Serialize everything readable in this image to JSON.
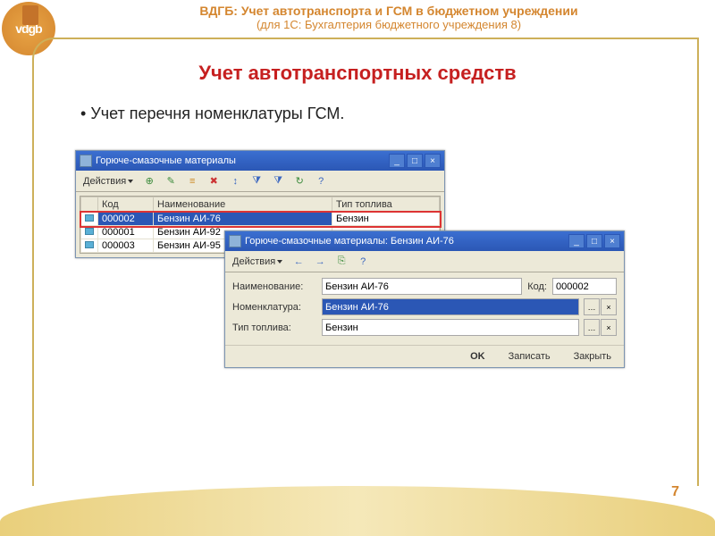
{
  "header": {
    "line1": "ВДГБ: Учет автотранспорта и ГСМ в бюджетном учреждении",
    "line2": "(для 1С: Бухгалтерия бюджетного учреждения 8)"
  },
  "logo_text": "vdgb",
  "page_title": "Учет автотранспортных средств",
  "bullet": "Учет перечня номенклатуры ГСМ.",
  "page_number": "7",
  "win1": {
    "title": "Горюче-смазочные материалы",
    "actions": "Действия",
    "cols": {
      "code": "Код",
      "name": "Наименование",
      "fuel": "Тип топлива"
    },
    "rows": [
      {
        "code": "000002",
        "name": "Бензин АИ-76",
        "fuel": "Бензин"
      },
      {
        "code": "000001",
        "name": "Бензин АИ-92",
        "fuel": ""
      },
      {
        "code": "000003",
        "name": "Бензин АИ-95",
        "fuel": ""
      }
    ]
  },
  "win2": {
    "title": "Горюче-смазочные материалы: Бензин АИ-76",
    "actions": "Действия",
    "labels": {
      "name": "Наименование:",
      "code": "Код:",
      "nomen": "Номенклатура:",
      "fuel": "Тип топлива:"
    },
    "values": {
      "name": "Бензин АИ-76",
      "code": "000002",
      "nomen": "Бензин АИ-76",
      "fuel": "Бензин"
    },
    "footer": {
      "ok": "OK",
      "write": "Записать",
      "close": "Закрыть"
    }
  }
}
